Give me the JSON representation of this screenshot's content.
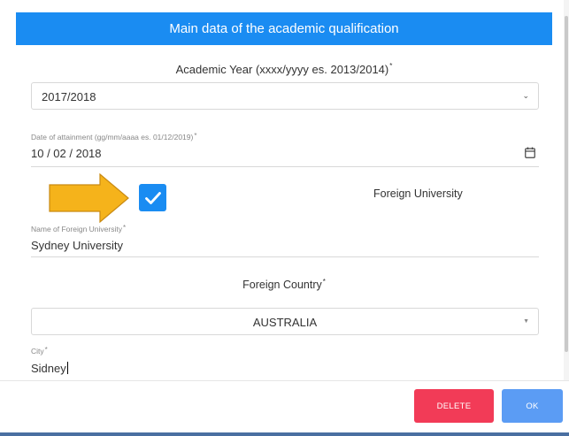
{
  "modal": {
    "title": "Main data of the academic qualification"
  },
  "academic_year": {
    "label": "Academic Year (xxxx/yyyy es. 2013/2014)",
    "required_mark": "*",
    "value": "2017/2018"
  },
  "date_of_attainment": {
    "label": "Date of attainment (gg/mm/aaaa es. 01/12/2019)",
    "required_mark": "*",
    "value": "10 / 02 / 2018"
  },
  "foreign_university": {
    "checked": true,
    "label": "Foreign University"
  },
  "foreign_university_name": {
    "label": "Name of Foreign University",
    "required_mark": "*",
    "value": "Sydney University"
  },
  "foreign_country": {
    "label": "Foreign Country",
    "required_mark": "*",
    "value": "AUSTRALIA"
  },
  "city": {
    "label": "City",
    "required_mark": "*",
    "value": "Sidney"
  },
  "footer": {
    "delete_label": "DELETE",
    "ok_label": "OK"
  },
  "colors": {
    "header": "#1a8cf2",
    "checkbox": "#1a8cf2",
    "delete_button": "#f23b57",
    "ok_button": "#5b9cf4",
    "annotation_arrow": "#f5b31b"
  }
}
